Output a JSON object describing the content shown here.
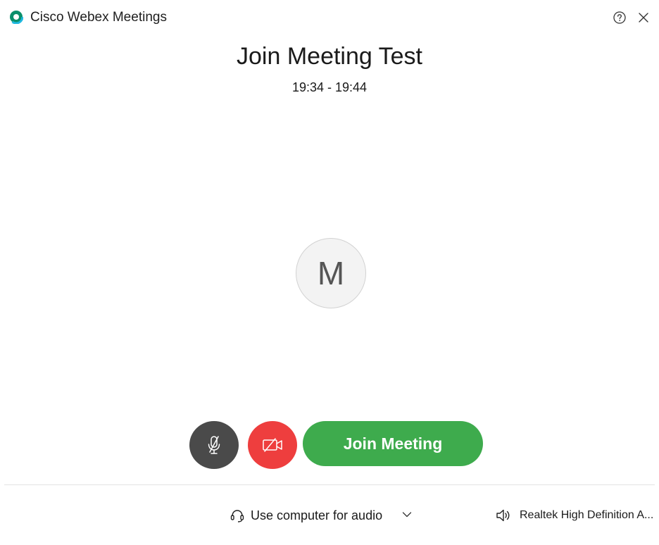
{
  "window": {
    "app_title": "Cisco Webex Meetings",
    "logo_icon": "webex-logo",
    "help_icon": "help-circle-icon",
    "close_icon": "close-icon"
  },
  "meeting": {
    "title": "Join Meeting Test",
    "time": "19:34 - 19:44"
  },
  "avatar": {
    "initial": "M"
  },
  "controls": {
    "mute_icon": "microphone-muted-icon",
    "video_icon": "video-off-icon",
    "join_label": "Join Meeting"
  },
  "footer": {
    "audio_label": "Use computer for audio",
    "audio_icon": "headset-icon",
    "speaker_label": "Realtek High Definition A...",
    "speaker_icon": "speaker-icon"
  },
  "colors": {
    "join_button": "#3eab4d",
    "video_button": "#ee3e3e",
    "mute_button": "#4a4a4a",
    "logo_green": "#0ea37a"
  }
}
